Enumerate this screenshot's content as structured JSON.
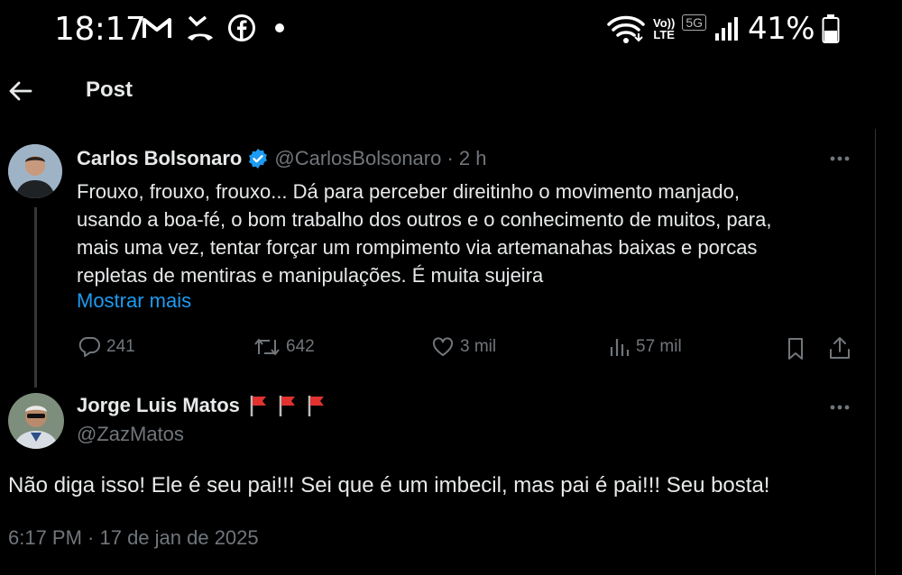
{
  "status_bar": {
    "time": "18:17",
    "battery": "41%",
    "volte_top": "Vo))",
    "volte_bottom": "LTE",
    "network": "5G"
  },
  "header": {
    "title": "Post"
  },
  "tweet": {
    "author_name": "Carlos Bolsonaro",
    "author_handle": "@CarlosBolsonaro · 2 h",
    "lines": [
      "Frouxo, frouxo, frouxo... Dá para perceber direitinho o movimento manjado,",
      "usando a boa-fé, o bom trabalho dos outros e o conhecimento de muitos, para,",
      "mais uma vez, tentar forçar um rompimento via artemanahas baixas e porcas",
      "repletas de mentiras e manipulações. É muita sujeira"
    ],
    "show_more": "Mostrar mais",
    "replies": "241",
    "retweets": "642",
    "likes": "3 mil",
    "views": "57 mil"
  },
  "reply": {
    "author_name": "Jorge Luis Matos",
    "author_handle": "@ZazMatos",
    "text": "Não diga isso! Ele é seu pai!!! Sei que é um imbecil, mas pai é pai!!! Seu bosta!",
    "timestamp": "6:17 PM · 17 de jan de 2025"
  },
  "colors": {
    "accent": "#1d9bf0",
    "muted": "#71767b",
    "flag": "#e0322f"
  }
}
